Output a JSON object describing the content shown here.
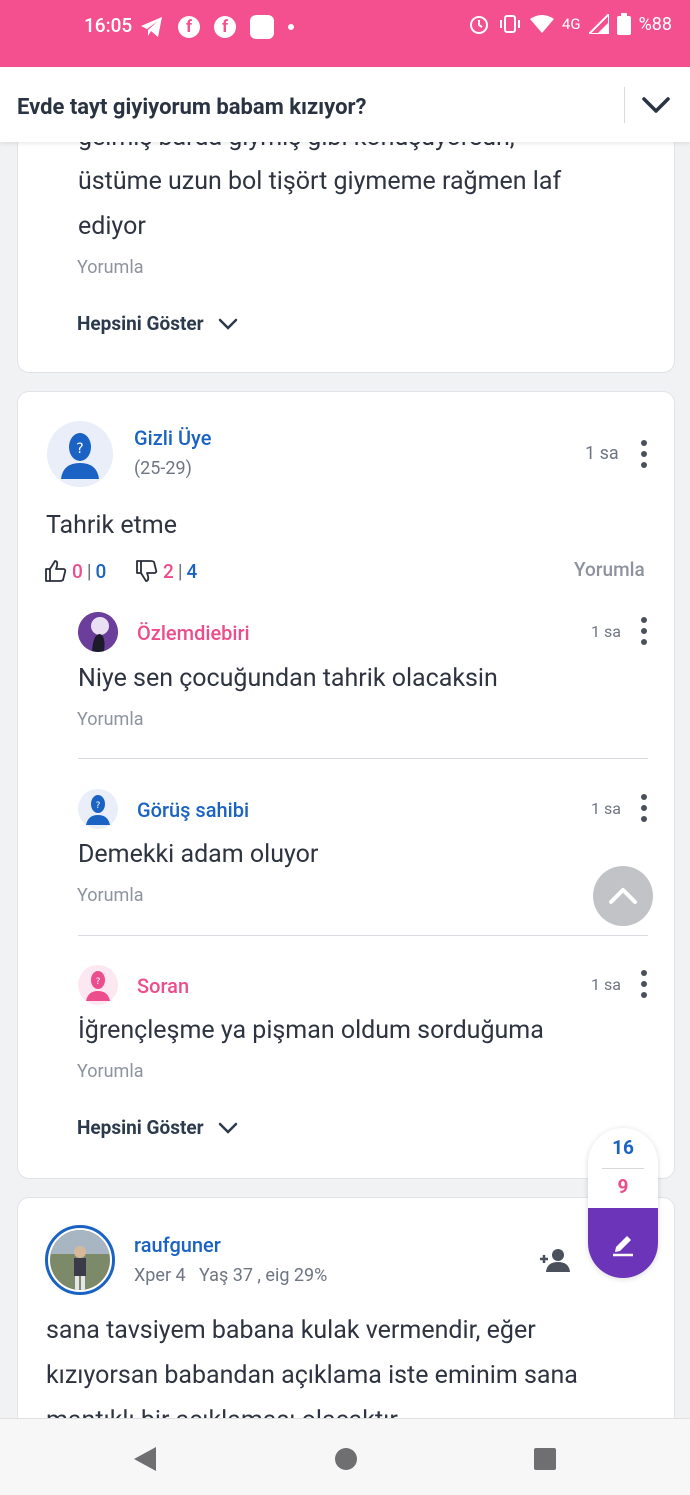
{
  "status_bar": {
    "time": "16:05",
    "network": "4G",
    "battery": "%88"
  },
  "header": {
    "title": "Evde tayt giyiyorum babam kızıyor?"
  },
  "card1": {
    "partial_line": "gelmiş barda giymiş gibi konuşuyorsun,",
    "line1": "üstüme uzun bol tişört giymeme rağmen laf",
    "line2": "ediyor",
    "comment_label": "Yorumla",
    "show_all": "Hepsini Göster"
  },
  "card2": {
    "author": {
      "name": "Gizli Üye",
      "age": "(25-29)",
      "time": "1 sa"
    },
    "body": "Tahrik etme",
    "likes": {
      "pink": "0",
      "sep": "|",
      "blue": "0"
    },
    "dislikes": {
      "pink": "2",
      "sep": "|",
      "blue": "4"
    },
    "comment_label": "Yorumla",
    "replies": [
      {
        "name": "Özlemdiebiri",
        "time": "1 sa",
        "text": "Niye sen çocuğundan tahrik olacaksin",
        "comment_label": "Yorumla"
      },
      {
        "name": "Görüş sahibi",
        "time": "1 sa",
        "text": "Demekki adam oluyor",
        "comment_label": "Yorumla"
      },
      {
        "name": "Soran",
        "time": "1 sa",
        "text": "İğrençleşme ya pişman oldum sorduğuma",
        "comment_label": "Yorumla"
      }
    ],
    "show_all": "Hepsini Göster"
  },
  "card3": {
    "author": {
      "name": "raufguner",
      "meta": "Xper 4   Yaş 37 , eig 29%"
    },
    "line1": "sana tavsiyem babana kulak vermendir, eğer",
    "line2": "kızıyorsan babandan açıklama iste eminim sana",
    "line3": "mantıklı bir açıklaması olacaktır"
  },
  "vote_pill": {
    "up": "16",
    "down": "9"
  },
  "colors": {
    "brand_pink": "#f4508f",
    "link_blue": "#1a63c4",
    "accent_purple": "#6c34b8"
  }
}
